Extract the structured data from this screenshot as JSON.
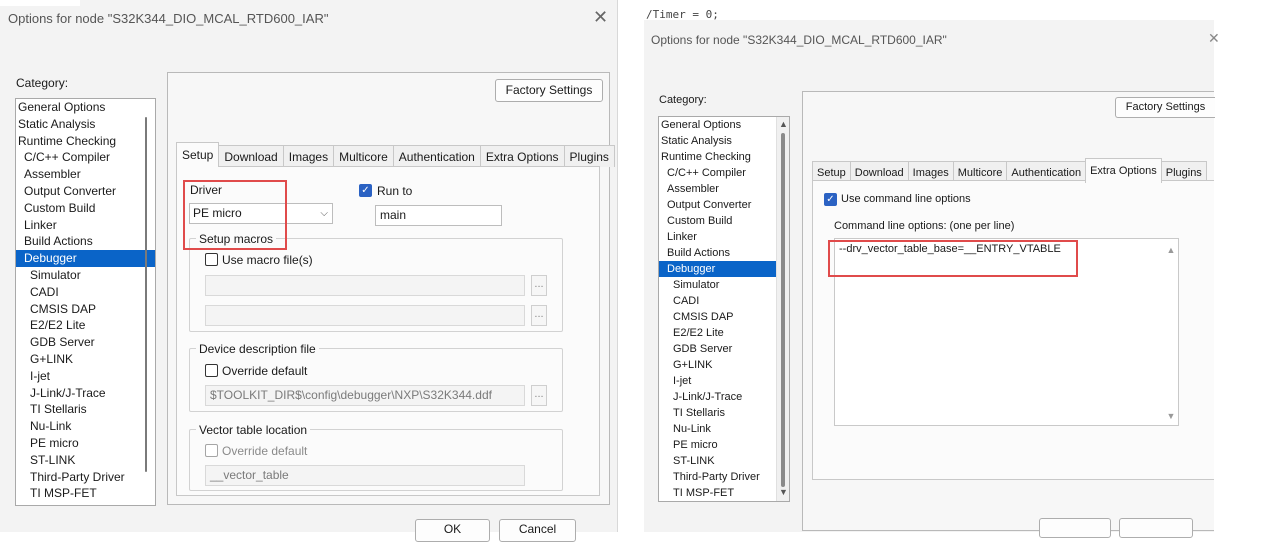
{
  "left": {
    "title": "Options for node \"S32K344_DIO_MCAL_RTD600_IAR\"",
    "category_label": "Category:",
    "factory_settings": "Factory Settings",
    "categories": [
      {
        "label": "General Options",
        "level": 1
      },
      {
        "label": "Static Analysis",
        "level": 1
      },
      {
        "label": "Runtime Checking",
        "level": 1
      },
      {
        "label": "C/C++ Compiler",
        "level": 2
      },
      {
        "label": "Assembler",
        "level": 2
      },
      {
        "label": "Output Converter",
        "level": 2
      },
      {
        "label": "Custom Build",
        "level": 2
      },
      {
        "label": "Linker",
        "level": 2
      },
      {
        "label": "Build Actions",
        "level": 2
      },
      {
        "label": "Debugger",
        "level": 2,
        "selected": true
      },
      {
        "label": "Simulator",
        "level": 3
      },
      {
        "label": "CADI",
        "level": 3
      },
      {
        "label": "CMSIS DAP",
        "level": 3
      },
      {
        "label": "E2/E2 Lite",
        "level": 3
      },
      {
        "label": "GDB Server",
        "level": 3
      },
      {
        "label": "G+LINK",
        "level": 3
      },
      {
        "label": "I-jet",
        "level": 3
      },
      {
        "label": "J-Link/J-Trace",
        "level": 3
      },
      {
        "label": "TI Stellaris",
        "level": 3
      },
      {
        "label": "Nu-Link",
        "level": 3
      },
      {
        "label": "PE micro",
        "level": 3
      },
      {
        "label": "ST-LINK",
        "level": 3
      },
      {
        "label": "Third-Party Driver",
        "level": 3
      },
      {
        "label": "TI MSP-FET",
        "level": 3
      }
    ],
    "tabs": [
      "Setup",
      "Download",
      "Images",
      "Multicore",
      "Authentication",
      "Extra Options",
      "Plugins"
    ],
    "active_tab": "Setup",
    "driver_label": "Driver",
    "driver_value": "PE micro",
    "run_to_label": "Run to",
    "run_to_value": "main",
    "setup_macros_label": "Setup macros",
    "use_macro_files_label": "Use macro file(s)",
    "device_desc_label": "Device description file",
    "override_default_label": "Override default",
    "device_desc_path": "$TOOLKIT_DIR$\\config\\debugger\\NXP\\S32K344.ddf",
    "vector_table_label": "Vector table location",
    "vector_override_label": "Override default",
    "vector_table_value": "__vector_table",
    "ellipsis": "...",
    "ok": "OK",
    "cancel": "Cancel"
  },
  "right": {
    "title": "Options for node \"S32K344_DIO_MCAL_RTD600_IAR\"",
    "category_label": "Category:",
    "factory_settings": "Factory Settings",
    "categories": [
      {
        "label": "General Options",
        "level": 1
      },
      {
        "label": "Static Analysis",
        "level": 1
      },
      {
        "label": "Runtime Checking",
        "level": 1
      },
      {
        "label": "C/C++ Compiler",
        "level": 2
      },
      {
        "label": "Assembler",
        "level": 2
      },
      {
        "label": "Output Converter",
        "level": 2
      },
      {
        "label": "Custom Build",
        "level": 2
      },
      {
        "label": "Linker",
        "level": 2
      },
      {
        "label": "Build Actions",
        "level": 2
      },
      {
        "label": "Debugger",
        "level": 2,
        "selected": true
      },
      {
        "label": "Simulator",
        "level": 3
      },
      {
        "label": "CADI",
        "level": 3
      },
      {
        "label": "CMSIS DAP",
        "level": 3
      },
      {
        "label": "E2/E2 Lite",
        "level": 3
      },
      {
        "label": "GDB Server",
        "level": 3
      },
      {
        "label": "G+LINK",
        "level": 3
      },
      {
        "label": "I-jet",
        "level": 3
      },
      {
        "label": "J-Link/J-Trace",
        "level": 3
      },
      {
        "label": "TI Stellaris",
        "level": 3
      },
      {
        "label": "Nu-Link",
        "level": 3
      },
      {
        "label": "PE micro",
        "level": 3
      },
      {
        "label": "ST-LINK",
        "level": 3
      },
      {
        "label": "Third-Party Driver",
        "level": 3
      },
      {
        "label": "TI MSP-FET",
        "level": 3
      }
    ],
    "tabs": [
      "Setup",
      "Download",
      "Images",
      "Multicore",
      "Authentication",
      "Extra Options",
      "Plugins"
    ],
    "active_tab": "Extra Options",
    "use_cmdline_label": "Use command line options",
    "cmdline_label": "Command line options:  (one per line)",
    "cmdline_value": "--drv_vector_table_base=__ENTRY_VTABLE",
    "background_code": "/Timer = 0;"
  },
  "colors": {
    "selection": "#0a64c8",
    "highlight_box": "#e04b4b",
    "checkbox_checked": "#2b62c3"
  }
}
